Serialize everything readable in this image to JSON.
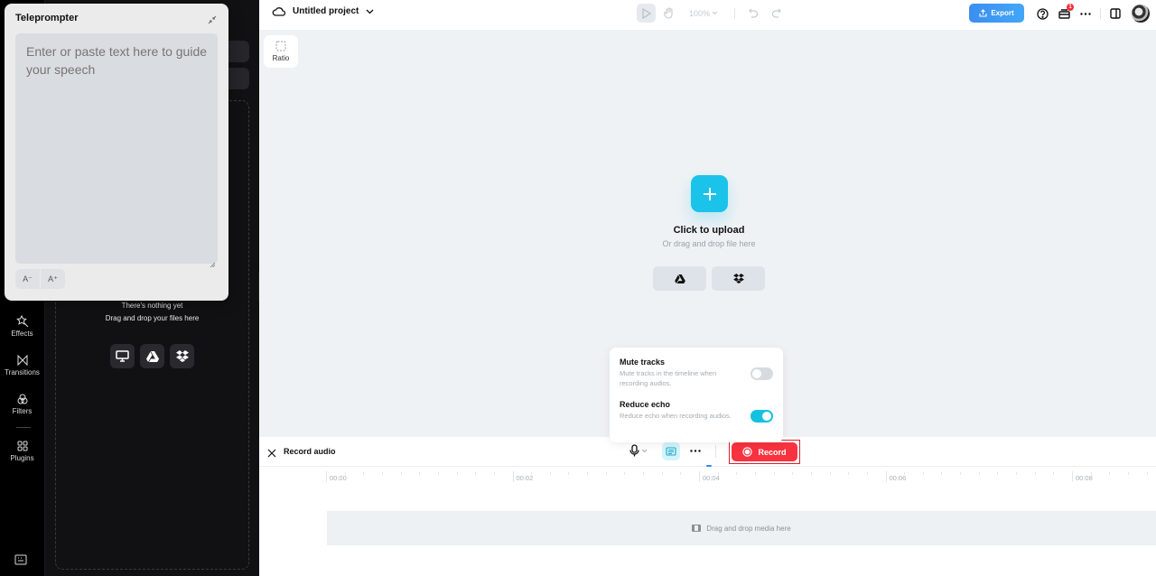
{
  "app": {
    "project_name": "Untitled project",
    "zoom_level": "100%",
    "export_label": "Export",
    "notification_count": "1"
  },
  "left_rail": {
    "items": [
      {
        "label": "Effects",
        "icon": "effects-icon"
      },
      {
        "label": "Transitions",
        "icon": "transitions-icon"
      },
      {
        "label": "Filters",
        "icon": "filters-icon"
      },
      {
        "label": "Plugins",
        "icon": "plugins-icon"
      }
    ]
  },
  "media_panel": {
    "empty_title": "There's nothing yet",
    "empty_subtitle": "Drag and drop your files here",
    "sources": [
      "computer-icon",
      "google-drive-icon",
      "dropbox-icon"
    ]
  },
  "teleprompter": {
    "title": "Teleprompter",
    "placeholder": "Enter or paste text here to guide your speech",
    "value": "",
    "decrease_font_label": "A⁻",
    "increase_font_label": "A⁺"
  },
  "canvas": {
    "ratio_label": "Ratio",
    "upload_title": "Click to upload",
    "upload_subtitle": "Or drag and drop file here",
    "upload_sources": [
      "google-drive-icon",
      "dropbox-icon"
    ]
  },
  "record_settings": {
    "mute_tracks": {
      "title": "Mute tracks",
      "description": "Mute tracks in the timeline when recording audios.",
      "enabled": false
    },
    "reduce_echo": {
      "title": "Reduce echo",
      "description": "Reduce echo when recording audios.",
      "enabled": true
    }
  },
  "record_bar": {
    "title": "Record audio",
    "record_label": "Record"
  },
  "timeline": {
    "ticks": [
      "00:00",
      "00:02",
      "00:04",
      "00:06",
      "00:08"
    ],
    "track_placeholder": "Drag and drop media here"
  }
}
